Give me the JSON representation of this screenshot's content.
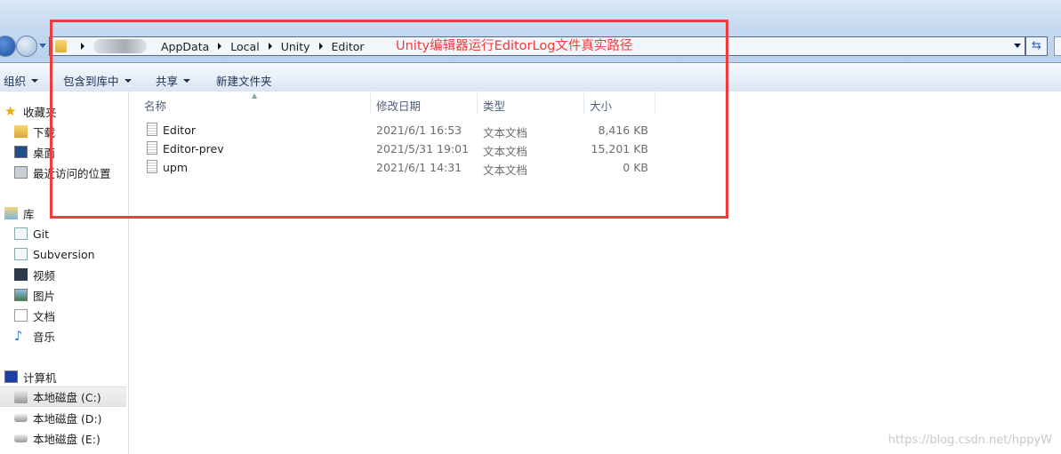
{
  "address_bar": {
    "crumbs": [
      "AppData",
      "Local",
      "Unity",
      "Editor"
    ]
  },
  "toolbar": {
    "organize": "组织",
    "include_in_library": "包含到库中",
    "share": "共享",
    "new_folder": "新建文件夹"
  },
  "sidebar": {
    "favorites": {
      "label": "收藏夹",
      "items": [
        "下载",
        "桌面",
        "最近访问的位置"
      ]
    },
    "libraries": {
      "label": "库",
      "items": [
        "Git",
        "Subversion",
        "视频",
        "图片",
        "文档",
        "音乐"
      ]
    },
    "computer": {
      "label": "计算机",
      "items": [
        "本地磁盘 (C:)",
        "本地磁盘 (D:)",
        "本地磁盘 (E:)"
      ],
      "selected": "本地磁盘 (C:)"
    }
  },
  "columns": {
    "name": "名称",
    "date": "修改日期",
    "type": "类型",
    "size": "大小"
  },
  "files": [
    {
      "name": "Editor",
      "date": "2021/6/1 16:53",
      "type": "文本文档",
      "size": "8,416 KB"
    },
    {
      "name": "Editor-prev",
      "date": "2021/5/31 19:01",
      "type": "文本文档",
      "size": "15,201 KB"
    },
    {
      "name": "upm",
      "date": "2021/6/1 14:31",
      "type": "文本文档",
      "size": "0 KB"
    }
  ],
  "annotation": {
    "text": "Unity编辑器运行EditorLog文件真实路径",
    "color": "#f03c3c"
  },
  "watermark": "https://blog.csdn.net/hppyW"
}
